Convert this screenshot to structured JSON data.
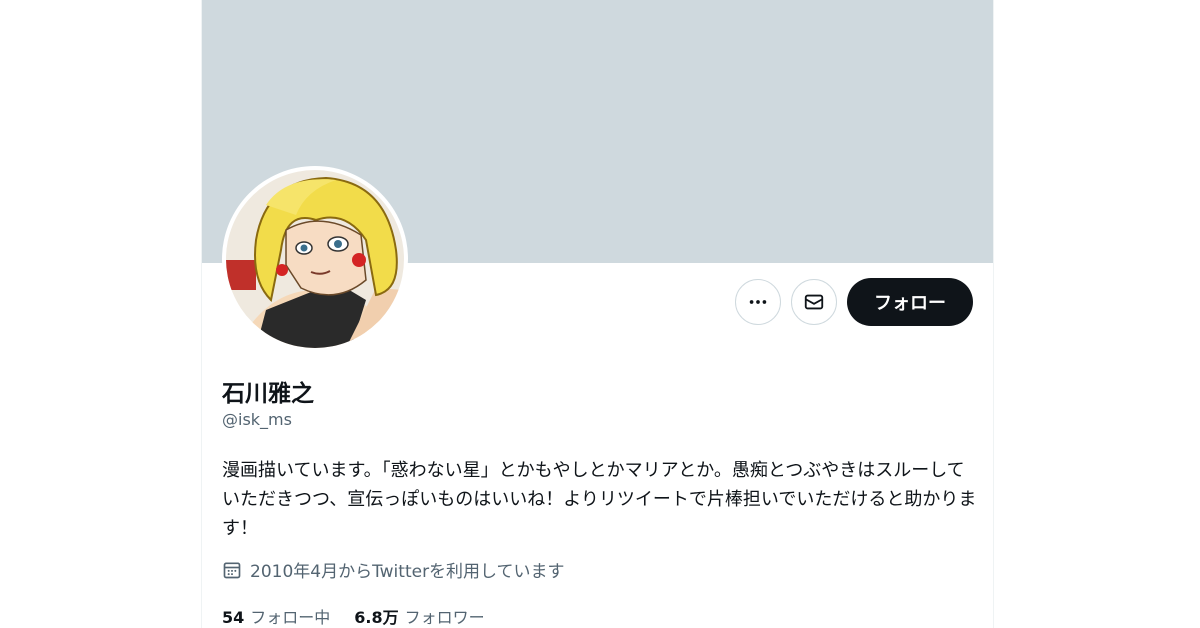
{
  "profile": {
    "name": "石川雅之",
    "handle": "@isk_ms",
    "bio": "漫画描いています。「惑わない星」とかもやしとかマリアとか。愚痴とつぶやきはスルーしていただきつつ、宣伝っぽいものはいいね！よりリツイートで片棒担いでいただけると助かります！",
    "joined": "2010年4月からTwitterを利用しています",
    "following_count": "54",
    "following_label": "フォロー中",
    "followers_count": "6.8万",
    "followers_label": "フォロワー"
  },
  "actions": {
    "more_icon": "more-icon",
    "message_icon": "envelope-icon",
    "follow_label": "フォロー"
  },
  "colors": {
    "banner": "#cfd9de",
    "text_primary": "#0f1419",
    "text_secondary": "#536471",
    "follow_button_bg": "#0f1419",
    "border": "#cfd9de"
  }
}
